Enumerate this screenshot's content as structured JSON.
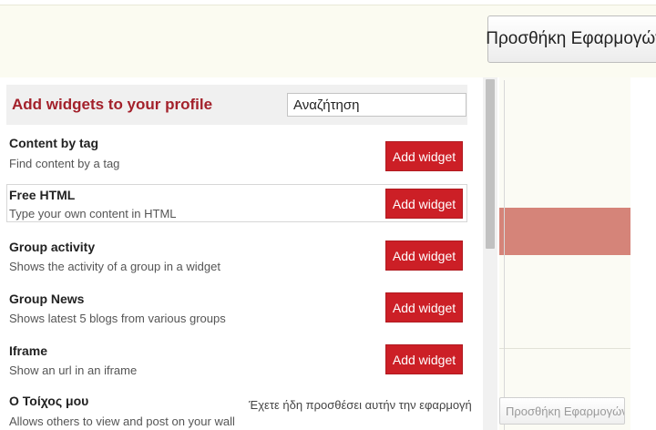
{
  "top_button_label": "Προσθήκη Εφαρμογών",
  "background_button_label": "Προσθήκη Εφαρμογών",
  "panel": {
    "title": "Add widgets to your profile",
    "search_value": "Αναζήτηση"
  },
  "widgets": [
    {
      "title": "Content by tag",
      "description": "Find content by a tag",
      "action": "Add widget"
    },
    {
      "title": "Free HTML",
      "description": "Type your own content in HTML",
      "action": "Add widget"
    },
    {
      "title": "Group activity",
      "description": "Shows the activity of a group in a widget",
      "action": "Add widget"
    },
    {
      "title": "Group News",
      "description": "Shows latest 5 blogs from various groups",
      "action": "Add widget"
    },
    {
      "title": "Iframe",
      "description": "Show an url in an iframe",
      "action": "Add widget"
    },
    {
      "title": "Ο Τοίχος μου",
      "description": "Allows others to view and post on your wall",
      "status": "Έχετε ήδη προσθέσει αυτήν την εφαρμογή"
    }
  ],
  "colors": {
    "accent_red": "#cc1f26",
    "title_red": "#a3212b",
    "header_band": "#fbfbf1",
    "bg_red_bar": "#d58479"
  }
}
